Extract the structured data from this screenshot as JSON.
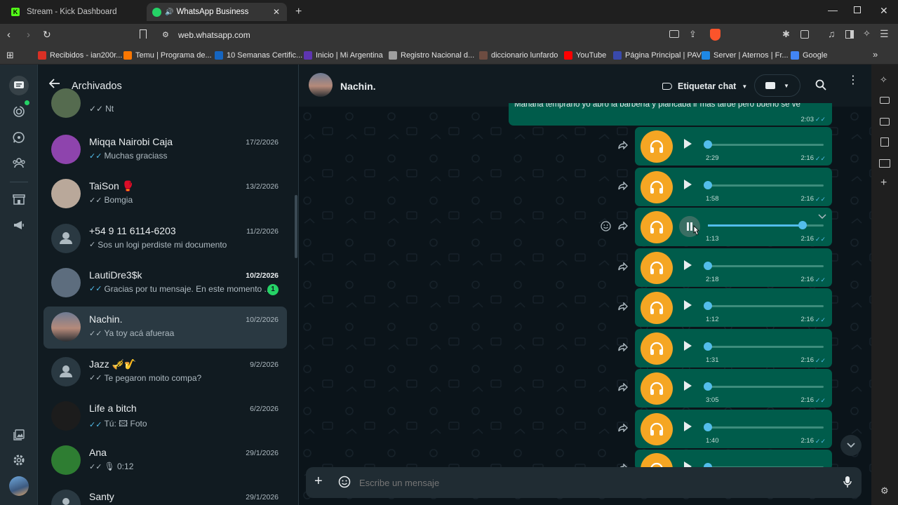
{
  "browser": {
    "tabs": [
      {
        "label": "Stream - Kick Dashboard",
        "active": false
      },
      {
        "label": "WhatsApp Business",
        "active": true
      }
    ],
    "url": "web.whatsapp.com",
    "bookmarks": [
      {
        "label": "Recibidos - ian200r...",
        "color": "#d93025"
      },
      {
        "label": "Temu | Programa de...",
        "color": "#fb7701"
      },
      {
        "label": "10 Semanas Certific...",
        "color": "#1565c0"
      },
      {
        "label": "Inicio | Mi Argentina",
        "color": "#5e35b1"
      },
      {
        "label": "Registro Nacional d...",
        "color": "#9e9e9e"
      },
      {
        "label": "diccionario lunfardo",
        "color": "#6d4c41"
      },
      {
        "label": "YouTube",
        "color": "#ff0000"
      },
      {
        "label": "Página Principal | PAV",
        "color": "#3949ab"
      },
      {
        "label": "Server | Aternos | Fr...",
        "color": "#1e88e5"
      },
      {
        "label": "Google",
        "color": "#4285f4"
      }
    ],
    "bookmarks_more": "»"
  },
  "sidebar": {
    "title": "Archivados",
    "partial_top_preview": "Nt",
    "chats": [
      {
        "name": "Miqqa Nairobi Caja",
        "date": "17/2/2026",
        "preview": "Muchas graciass",
        "ticks": "read",
        "avatar": "#8e44ad"
      },
      {
        "name": "TaiSon 🥊",
        "date": "13/2/2026",
        "preview": "Bomgia",
        "ticks": "delivered",
        "avatar": "#b9a89a"
      },
      {
        "name": "+54 9 11 6114-6203",
        "date": "11/2/2026",
        "preview": "Sos un logi perdiste mi documento",
        "ticks": "sent",
        "avatar": "default"
      },
      {
        "name": "LautiDre3$k",
        "date": "10/2/2026",
        "preview": "Gracias por tu mensaje. En este momento ...",
        "ticks": "read",
        "unread": "1",
        "avatar": "#5d6d7e"
      },
      {
        "name": "Nachin.",
        "date": "10/2/2026",
        "preview": "Ya toy acá afueraa",
        "ticks": "delivered",
        "selected": true,
        "avatar": "sunset"
      },
      {
        "name": "Jazz 🎺🎷",
        "date": "9/2/2026",
        "preview": "Te pegaron moito compa?",
        "ticks": "delivered",
        "avatar": "default"
      },
      {
        "name": "Life a bitch",
        "date": "6/2/2026",
        "preview": "Tú: 🖾 Foto",
        "ticks": "read",
        "avatar": "#1c1c1c"
      },
      {
        "name": "Ana",
        "date": "29/1/2026",
        "preview": "🎙 0:12",
        "ticks": "delivered",
        "avatar": "#2e7d32"
      },
      {
        "name": "Santy",
        "date": "29/1/2026",
        "preview": "",
        "ticks": "",
        "avatar": "default"
      }
    ]
  },
  "conversation": {
    "contact_name": "Nachin.",
    "label_chat": "Etiquetar chat",
    "top_text_message": {
      "text": "Mañana temprano yo abro la barbería y plancaba ir más tarde pero bueno se ve",
      "time": "2:03"
    },
    "voice_messages": [
      {
        "duration": "2:29",
        "time": "2:16",
        "progress": 0.0,
        "playing": false
      },
      {
        "duration": "1:58",
        "time": "2:16",
        "progress": 0.0,
        "playing": false
      },
      {
        "duration": "1:13",
        "time": "2:16",
        "progress": 0.82,
        "playing": true
      },
      {
        "duration": "2:18",
        "time": "2:16",
        "progress": 0.0,
        "playing": false
      },
      {
        "duration": "1:12",
        "time": "2:16",
        "progress": 0.0,
        "playing": false
      },
      {
        "duration": "1:31",
        "time": "2:16",
        "progress": 0.0,
        "playing": false
      },
      {
        "duration": "3:05",
        "time": "2:16",
        "progress": 0.0,
        "playing": false
      },
      {
        "duration": "1:40",
        "time": "2:16",
        "progress": 0.0,
        "playing": false
      },
      {
        "duration": "",
        "time": "",
        "progress": 0.0,
        "playing": false
      }
    ],
    "composer_placeholder": "Escribe un mensaje"
  },
  "colors": {
    "accent": "#00a884",
    "bubble": "#005c4b",
    "headphone_avatar": "#f5a623",
    "tick_read": "#53bdeb"
  }
}
